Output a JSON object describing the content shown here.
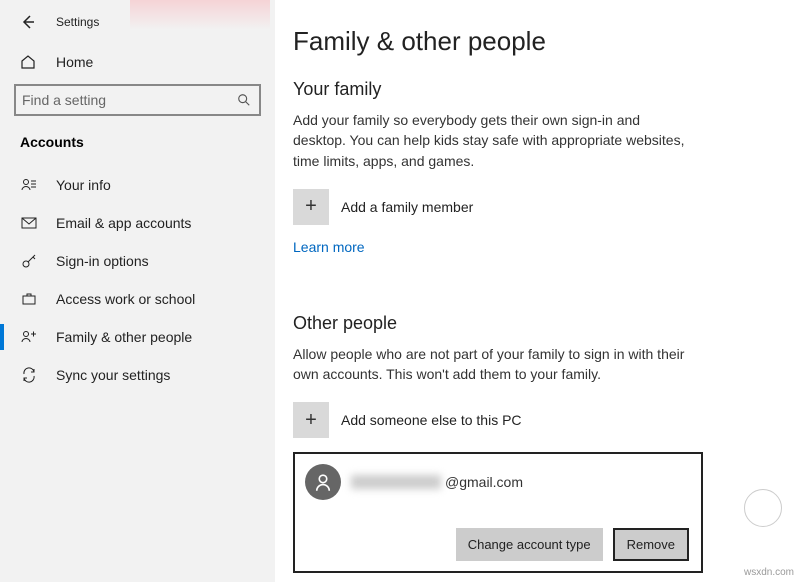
{
  "header": {
    "title": "Settings"
  },
  "home": {
    "label": "Home"
  },
  "search": {
    "placeholder": "Find a setting"
  },
  "sidebar": {
    "section": "Accounts",
    "items": [
      {
        "label": "Your info"
      },
      {
        "label": "Email & app accounts"
      },
      {
        "label": "Sign-in options"
      },
      {
        "label": "Access work or school"
      },
      {
        "label": "Family & other people"
      },
      {
        "label": "Sync your settings"
      }
    ]
  },
  "page": {
    "title": "Family & other people",
    "family": {
      "heading": "Your family",
      "desc": "Add your family so everybody gets their own sign-in and desktop. You can help kids stay safe with appropriate websites, time limits, apps, and games.",
      "add_label": "Add a family member",
      "learn_more": "Learn more"
    },
    "other": {
      "heading": "Other people",
      "desc": "Allow people who are not part of your family to sign in with their own accounts. This won't add them to your family.",
      "add_label": "Add someone else to this PC"
    },
    "account": {
      "email_suffix": "@gmail.com",
      "change_btn": "Change account type",
      "remove_btn": "Remove"
    }
  },
  "watermark": "wsxdn.com"
}
